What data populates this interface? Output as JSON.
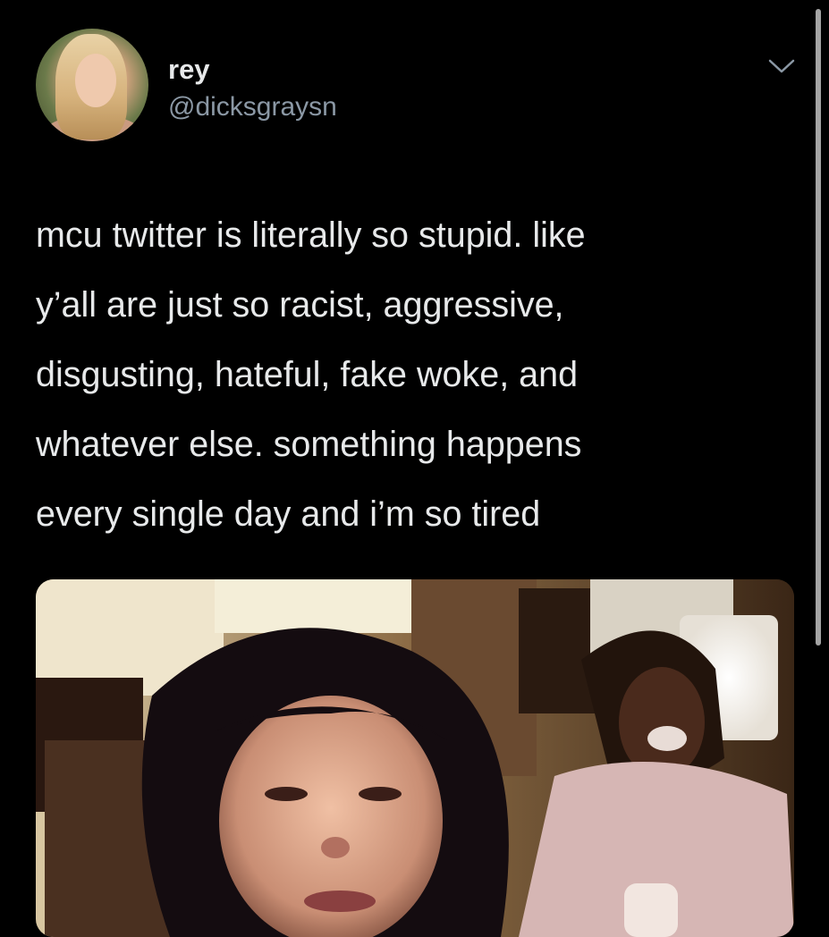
{
  "tweet": {
    "author": {
      "name": "rey",
      "handle": "@dicksgraysn"
    },
    "text": "mcu twitter is literally so stupid. like\ny’all are just so racist, aggressive,\ndisgusting, hateful, fake woke, and\nwhatever else. something happens\nevery single day and i’m so tired",
    "menu_icon": "chevron-down-icon",
    "media_description_icon": "video-thumbnail"
  },
  "colors": {
    "background": "#000000",
    "text_primary": "#e7e9ea",
    "text_secondary": "#8b98a5"
  }
}
